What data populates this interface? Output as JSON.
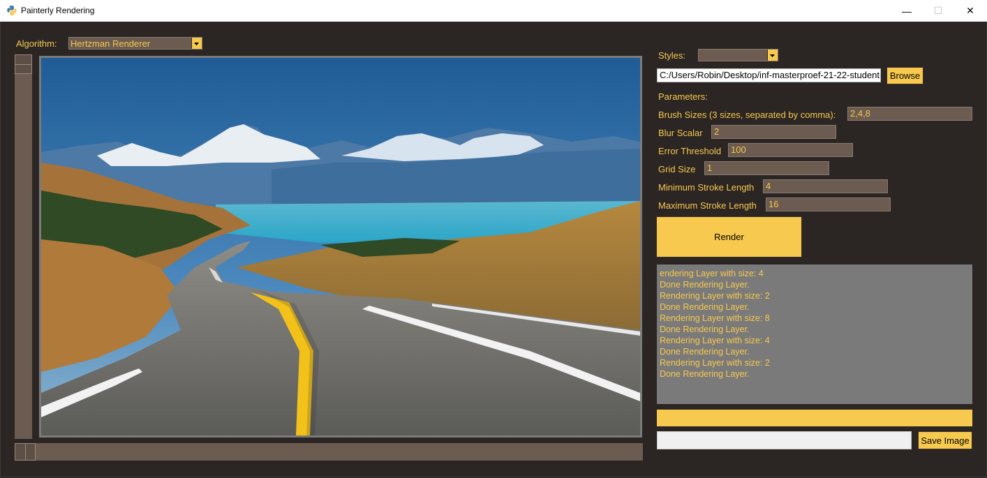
{
  "window": {
    "title": "Painterly Rendering",
    "minimize": "—",
    "maximize": "☐",
    "close": "✕"
  },
  "algorithm": {
    "label": "Algorithm:",
    "selected": "Hertzman Renderer"
  },
  "styles": {
    "label": "Styles:",
    "selected": ""
  },
  "file": {
    "path": "C:/Users/Robin/Desktop/inf-masterproef-21-22-student-",
    "browse_label": "Browse"
  },
  "parameters": {
    "heading": "Parameters:",
    "brush_sizes": {
      "label": "Brush Sizes (3 sizes, separated by comma):",
      "value": "2,4,8"
    },
    "blur_scalar": {
      "label": "Blur Scalar",
      "value": "2"
    },
    "error_threshold": {
      "label": "Error Threshold",
      "value": "100"
    },
    "grid_size": {
      "label": "Grid Size",
      "value": "1"
    },
    "min_stroke": {
      "label": "Minimum Stroke Length",
      "value": "4"
    },
    "max_stroke": {
      "label": "Maximum Stroke Length",
      "value": "16"
    }
  },
  "render_label": "Render",
  "log": {
    "lines": [
      "endering Layer with size: 4",
      "Done Rendering Layer.",
      "Rendering Layer with size: 2",
      "Done Rendering Layer.",
      "Rendering Layer with size: 8",
      "Done Rendering Layer.",
      "Rendering Layer with size: 4",
      "Done Rendering Layer.",
      "Rendering Layer with size: 2",
      "Done Rendering Layer."
    ]
  },
  "progress": {
    "fraction": 1.0
  },
  "save": {
    "path": "",
    "label": "Save Image"
  },
  "colors": {
    "background": "#2b2624",
    "accent": "#f7c94e",
    "field": "#6b5b50",
    "log_bg": "#7a7a7a"
  }
}
